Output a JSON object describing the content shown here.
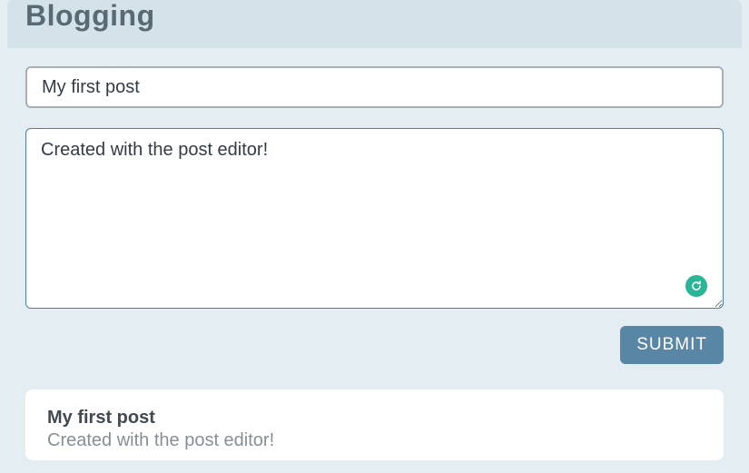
{
  "header": {
    "title": "Blogging"
  },
  "form": {
    "title_value": "My first post",
    "title_placeholder": "",
    "body_value": "Created with the post editor!",
    "body_placeholder": "",
    "submit_label": "SUBMIT"
  },
  "assistant_badge": {
    "icon": "grammarly-icon",
    "color": "#2bb597"
  },
  "posts": [
    {
      "title": "My first post",
      "body": "Created with the post editor!"
    }
  ]
}
